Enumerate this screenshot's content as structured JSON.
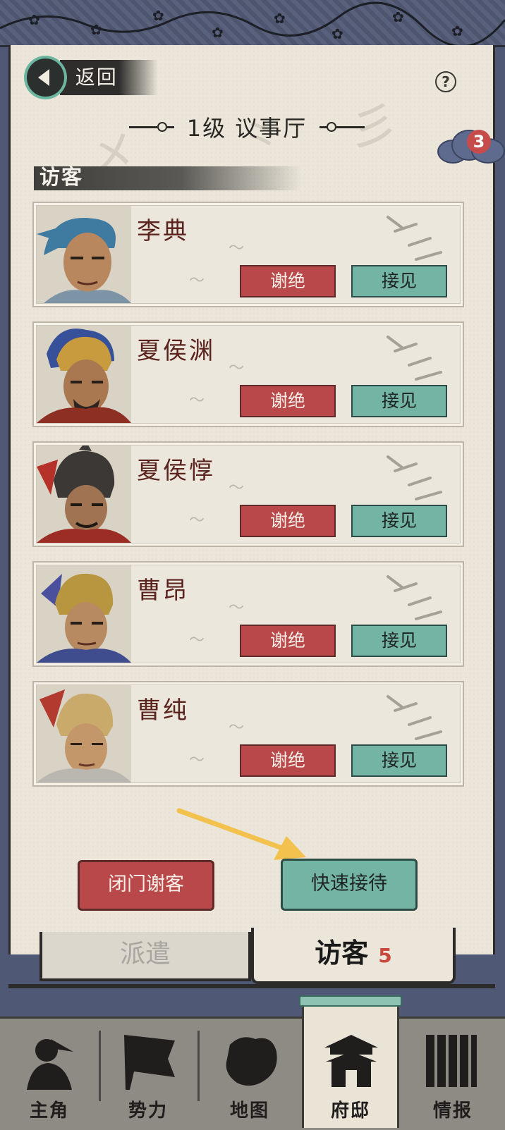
{
  "header": {
    "back_label": "返回",
    "help_icon": "question-mark-icon",
    "title": "1级  议事厅",
    "badge_count": "3"
  },
  "section": {
    "label": "访客"
  },
  "visitors": [
    {
      "name": "李典",
      "refuse_label": "谢绝",
      "receive_label": "接见"
    },
    {
      "name": "夏侯渊",
      "refuse_label": "谢绝",
      "receive_label": "接见"
    },
    {
      "name": "夏侯惇",
      "refuse_label": "谢绝",
      "receive_label": "接见"
    },
    {
      "name": "曹昂",
      "refuse_label": "谢绝",
      "receive_label": "接见"
    },
    {
      "name": "曹纯",
      "refuse_label": "谢绝",
      "receive_label": "接见"
    }
  ],
  "actions": {
    "close_door_label": "闭门谢客",
    "quick_receive_label": "快速接待"
  },
  "tabs": {
    "dispatch_label": "派遣",
    "visitors_label": "访客",
    "visitors_count": "5",
    "active": "访客"
  },
  "nav": {
    "items": [
      {
        "label": "主角",
        "icon": "warrior-silhouette-icon"
      },
      {
        "label": "势力",
        "icon": "flag-icon"
      },
      {
        "label": "地图",
        "icon": "map-icon"
      },
      {
        "label": "府邸",
        "icon": "mansion-icon"
      },
      {
        "label": "情报",
        "icon": "scroll-icon"
      }
    ],
    "active": "府邸"
  },
  "colors": {
    "refuse_red": "#b9484a",
    "receive_teal": "#74b4a4",
    "paper": "#ebe6d9",
    "frame_blue": "#4f5874",
    "badge_red": "#c64c4c",
    "arrow_yellow": "#f2c14e"
  }
}
